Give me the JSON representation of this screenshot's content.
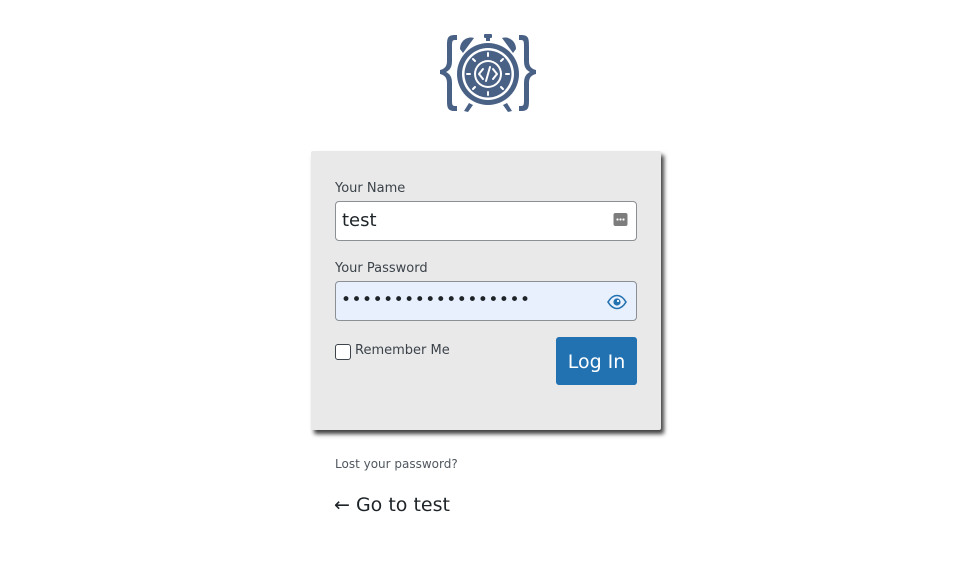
{
  "logo": {
    "icon": "alarm-clock-code-icon",
    "color": "#4a6186"
  },
  "form": {
    "username_label": "Your Name",
    "username_value": "test",
    "password_label": "Your Password",
    "password_masked": "••••••••••••••••••",
    "remember_label": "Remember Me",
    "remember_checked": false,
    "submit_label": "Log In"
  },
  "links": {
    "lost_password": "Lost your password?",
    "back_to_site": "← Go to test"
  },
  "colors": {
    "primary_button": "#2271b1",
    "card_background": "#e9e9e9",
    "autofill_background": "#e8f0fe"
  }
}
